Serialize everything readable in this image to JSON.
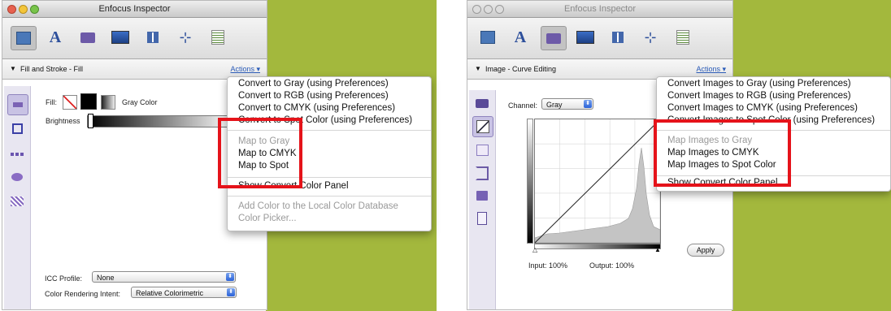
{
  "left_panel": {
    "window_title": "Enfocus Inspector",
    "section_title": "Fill and Stroke - Fill",
    "actions_label": "Actions",
    "fill_label": "Fill:",
    "color_name": "Gray Color",
    "brightness_label": "Brightness",
    "icc_label": "ICC Profile:",
    "icc_value": "None",
    "intent_label": "Color Rendering Intent:",
    "intent_value": "Relative Colorimetric",
    "menu": {
      "convert": [
        "Convert to Gray (using Preferences)",
        "Convert to RGB (using Preferences)",
        "Convert to CMYK (using Preferences)",
        "Convert to Spot Color (using Preferences)"
      ],
      "map": [
        "Map to Gray",
        "Map to CMYK",
        "Map to Spot"
      ],
      "show_panel": "Show Convert Color Panel",
      "add_color": "Add Color to the Local Color Database",
      "color_picker": "Color Picker..."
    }
  },
  "right_panel": {
    "window_title": "Enfocus Inspector",
    "section_title": "Image - Curve Editing",
    "actions_label": "Actions",
    "channel_label": "Channel:",
    "channel_value": "Gray",
    "input_label": "Input:  100%",
    "output_label": "Output:  100%",
    "apply_label": "Apply",
    "menu": {
      "convert": [
        "Convert Images to Gray (using Preferences)",
        "Convert Images to RGB (using Preferences)",
        "Convert Images to CMYK (using Preferences)",
        "Convert Images to Spot Color (using Preferences)"
      ],
      "map": [
        "Map Images to Gray",
        "Map Images to CMYK",
        "Map Images to Spot Color"
      ],
      "show_panel": "Show Convert Color Panel"
    }
  },
  "colors": {
    "background_green": "#a3b83d",
    "highlight_red": "#e5131a",
    "actions_link": "#2a5bb8"
  }
}
